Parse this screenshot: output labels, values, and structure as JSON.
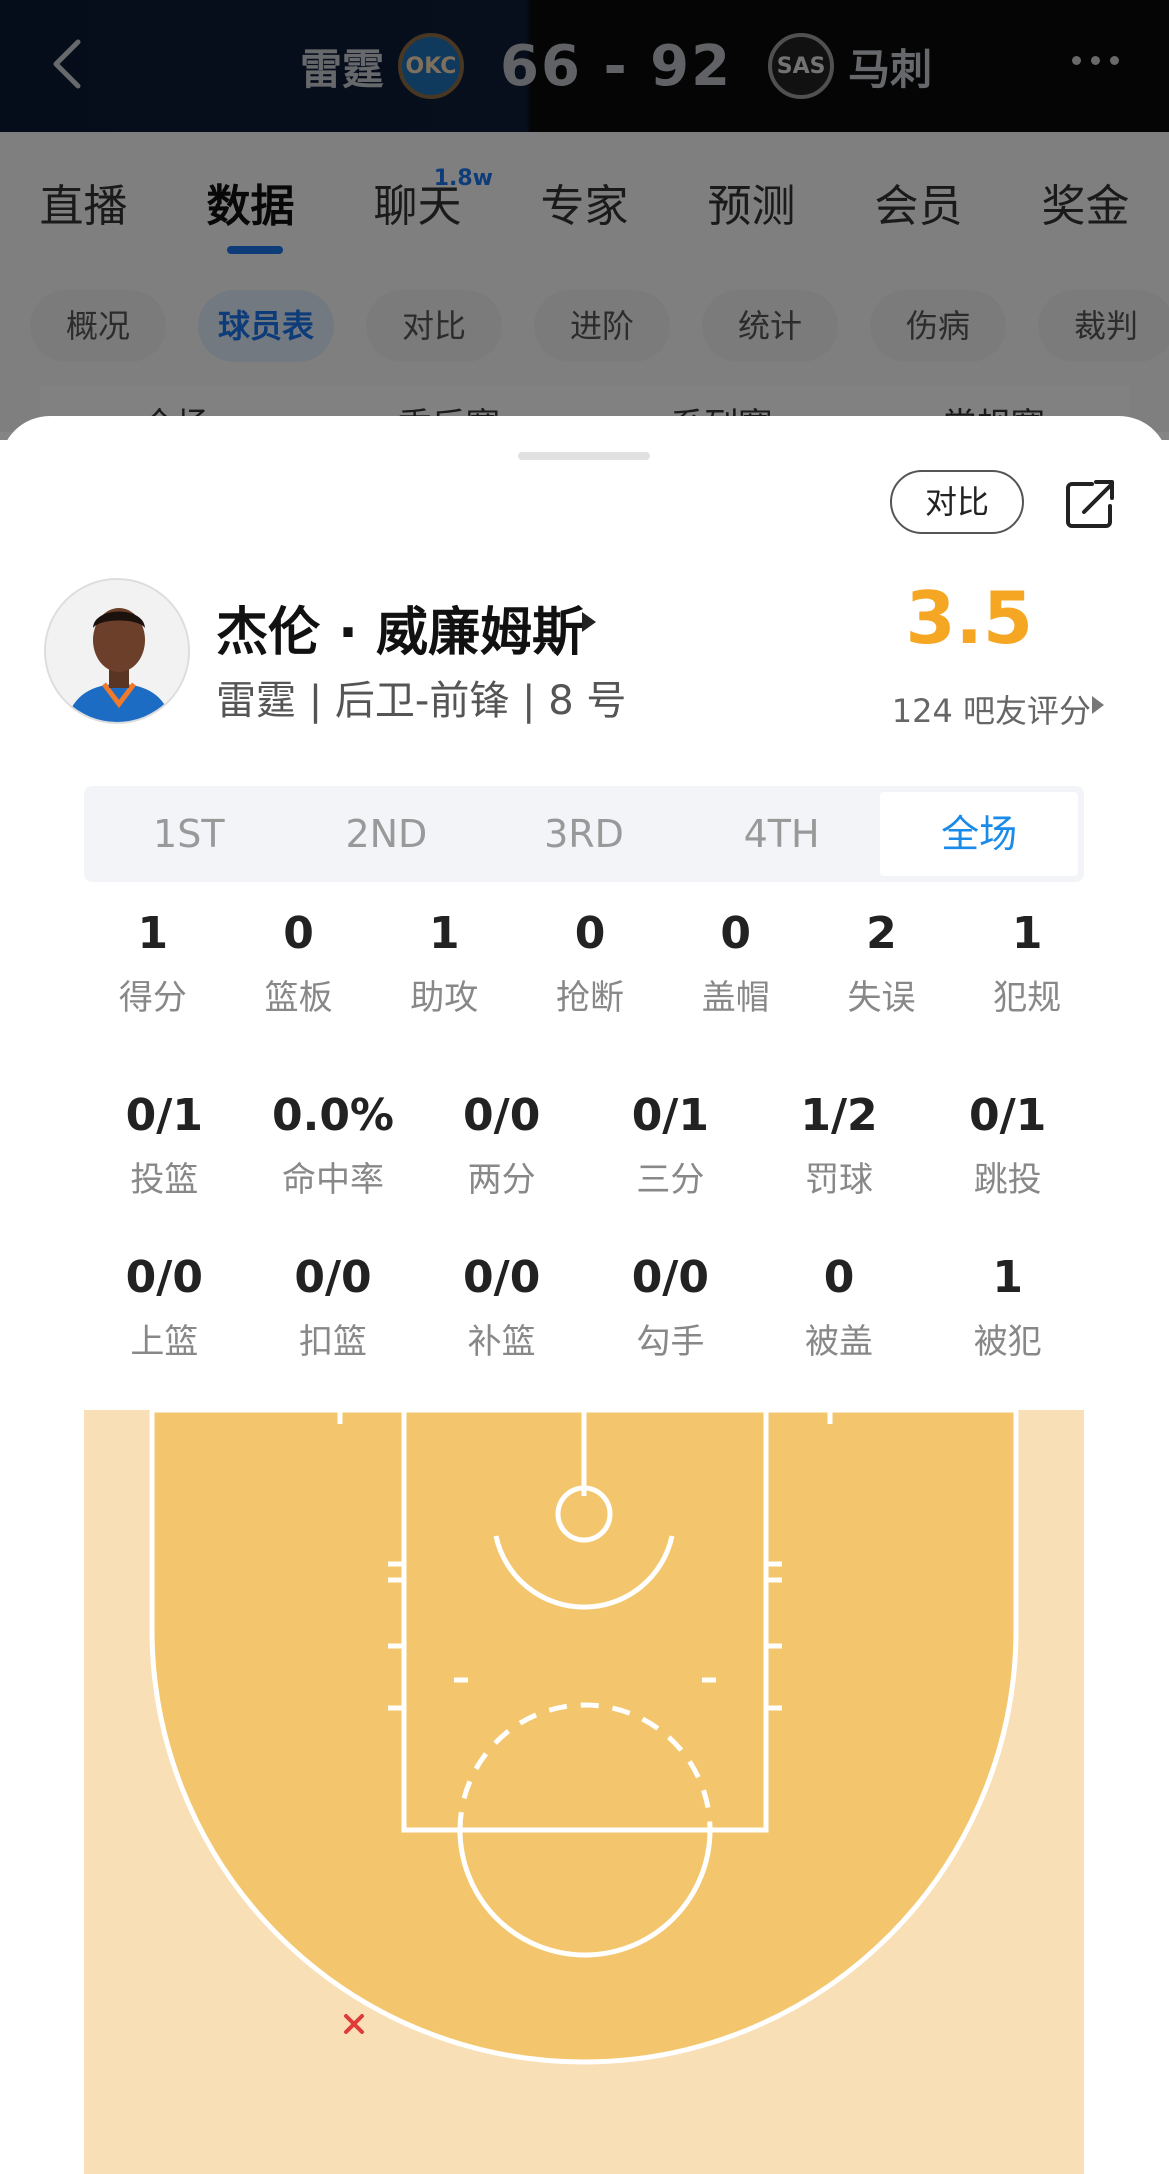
{
  "game": {
    "home_team": "雷霆",
    "home_logo_text": "OKC",
    "score": "66 - 92",
    "away_logo_text": "SAS",
    "away_team": "马刺"
  },
  "main_tabs": [
    {
      "label": "直播"
    },
    {
      "label": "数据"
    },
    {
      "label": "聊天",
      "badge": "1.8w"
    },
    {
      "label": "专家"
    },
    {
      "label": "预测"
    },
    {
      "label": "会员"
    },
    {
      "label": "奖金"
    }
  ],
  "sub_tabs": [
    "概况",
    "球员表",
    "对比",
    "进阶",
    "统计",
    "伤病",
    "裁判"
  ],
  "hidden_row": [
    "全场",
    "季后赛",
    "系列赛",
    "常规赛"
  ],
  "sheet": {
    "compare_label": "对比",
    "player_name": "杰伦 · 威廉姆斯",
    "player_meta": "雷霆 | 后卫-前锋 | 8 号",
    "rating": "3.5",
    "rating_label": "124 吧友评分"
  },
  "period_tabs": [
    "1ST",
    "2ND",
    "3RD",
    "4TH",
    "全场"
  ],
  "stats_row1": [
    {
      "value": "1",
      "label": "得分"
    },
    {
      "value": "0",
      "label": "篮板"
    },
    {
      "value": "1",
      "label": "助攻"
    },
    {
      "value": "0",
      "label": "抢断"
    },
    {
      "value": "0",
      "label": "盖帽"
    },
    {
      "value": "2",
      "label": "失误"
    },
    {
      "value": "1",
      "label": "犯规"
    }
  ],
  "stats_row2": [
    {
      "value": "0/1",
      "label": "投篮"
    },
    {
      "value": "0.0%",
      "label": "命中率"
    },
    {
      "value": "0/0",
      "label": "两分"
    },
    {
      "value": "0/1",
      "label": "三分"
    },
    {
      "value": "1/2",
      "label": "罚球"
    },
    {
      "value": "0/1",
      "label": "跳投"
    }
  ],
  "stats_row3": [
    {
      "value": "0/0",
      "label": "上篮"
    },
    {
      "value": "0/0",
      "label": "扣篮"
    },
    {
      "value": "0/0",
      "label": "补篮"
    },
    {
      "value": "0/0",
      "label": "勾手"
    },
    {
      "value": "0",
      "label": "被盖"
    },
    {
      "value": "1",
      "label": "被犯"
    }
  ],
  "colors": {
    "accent_blue": "#1a8be8",
    "rating_orange": "#f5a623",
    "court_inner": "#f3c66d",
    "court_outer": "#f8dfb5",
    "miss_marker": "#e03a3a"
  }
}
